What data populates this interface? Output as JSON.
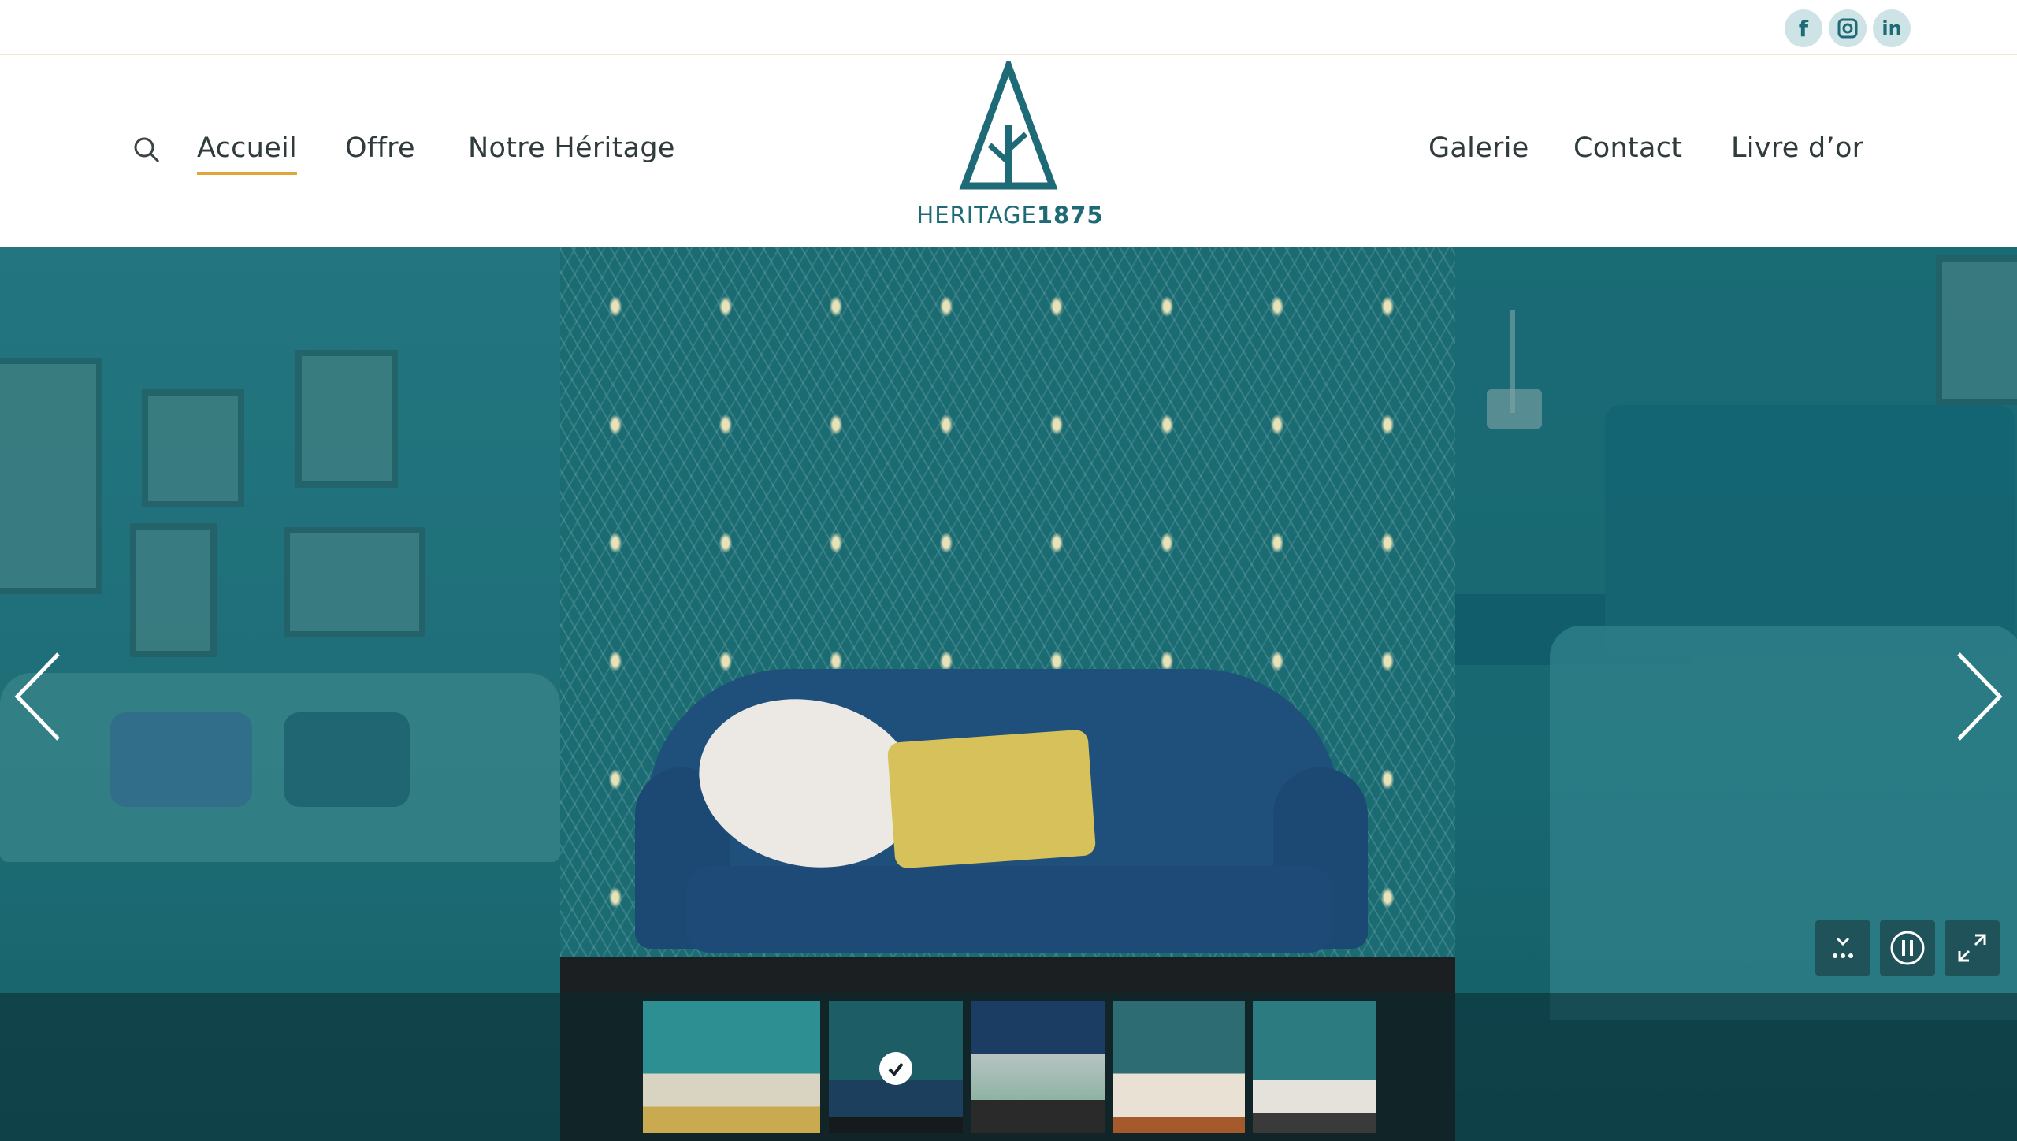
{
  "social": {
    "facebook": "f",
    "instagram": "◘",
    "linkedin": "in"
  },
  "nav": {
    "left": [
      {
        "label": "Accueil",
        "active": true
      },
      {
        "label": "Offre",
        "active": false
      },
      {
        "label": "Notre Héritage",
        "active": false
      }
    ],
    "right": [
      {
        "label": "Galerie",
        "active": false
      },
      {
        "label": "Contact",
        "active": false
      },
      {
        "label": "Livre d’or",
        "active": false
      }
    ]
  },
  "logo": {
    "name": "HERITAGE",
    "year": "1875"
  },
  "slider": {
    "thumbnails": [
      {
        "name": "living-room-teal",
        "selected": false
      },
      {
        "name": "peacock-sofa",
        "selected": true
      },
      {
        "name": "navy-bedroom",
        "selected": false
      },
      {
        "name": "white-bedroom",
        "selected": false
      },
      {
        "name": "teal-dresser",
        "selected": false
      }
    ]
  },
  "colors": {
    "brand": "#1e6b77",
    "accent_underline": "#e0a53b",
    "slider_bg": "#1a6f78"
  }
}
